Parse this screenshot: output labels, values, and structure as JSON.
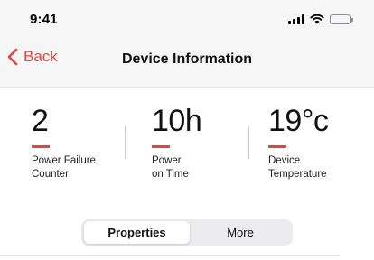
{
  "status_bar": {
    "time": "9:41",
    "icons": [
      "cellular-signal-icon",
      "wifi-icon",
      "battery-icon"
    ]
  },
  "nav": {
    "back_label": "Back",
    "title": "Device Information"
  },
  "stats": [
    {
      "value": "2",
      "label": "Power Failure\nCounter"
    },
    {
      "value": "10h",
      "label": "Power\non Time"
    },
    {
      "value": "19°c",
      "label": "Device\nTemperature"
    }
  ],
  "segmented_control": {
    "options": [
      "Properties",
      "More"
    ],
    "selected": "Properties"
  },
  "colors": {
    "accent": "#e8423b",
    "header_background": "#f6f6f7",
    "segment_background": "#ececee"
  }
}
